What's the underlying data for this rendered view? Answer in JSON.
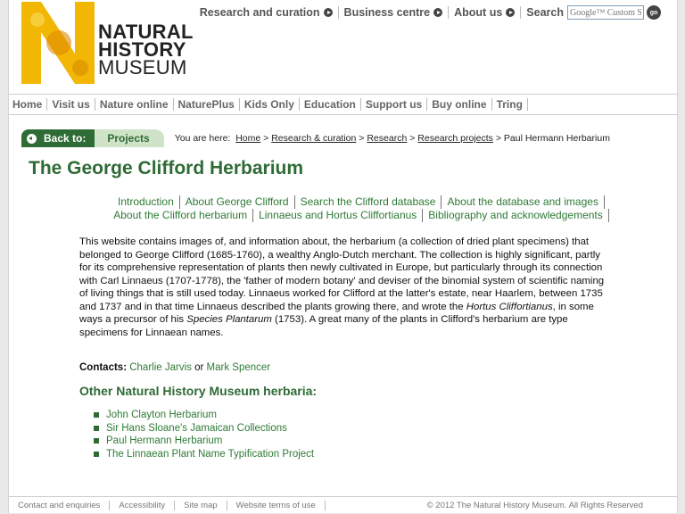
{
  "header": {
    "logo": {
      "line1": "NATURAL",
      "line2": "HISTORY",
      "line3": "MUSEUM"
    },
    "top_links": [
      {
        "label": "Research and curation"
      },
      {
        "label": "Business centre"
      },
      {
        "label": "About us"
      }
    ],
    "search": {
      "label": "Search",
      "placeholder": "Google™ Custom Search",
      "go_label": "go"
    }
  },
  "main_nav": [
    "Home",
    "Visit us",
    "Nature online",
    "NaturePlus",
    "Kids Only",
    "Education",
    "Support us",
    "Buy online",
    "Tring"
  ],
  "crumb_bar": {
    "back_label": "Back to:",
    "section_label": "Projects",
    "you_are_here": "You are here:",
    "crumbs": [
      "Home",
      "Research & curation",
      "Research",
      "Research projects"
    ],
    "separator": ">",
    "current": "Paul Hermann Herbarium"
  },
  "page_title": "The George Clifford Herbarium",
  "section_links": {
    "row1": [
      "Introduction",
      "About George Clifford",
      "Search the Clifford database",
      "About the database and images"
    ],
    "row2": [
      "About the Clifford herbarium",
      "Linnaeus and Hortus Cliffortianus",
      "Bibliography and acknowledgements"
    ]
  },
  "body": {
    "p1": "This website contains images of, and information about, the herbarium (a collection of dried plant specimens) that belonged to George Clifford (1685-1760), a wealthy Anglo-Dutch merchant. The collection is highly significant, partly for its comprehensive representation of plants then newly cultivated in Europe, but particularly through its connection with Carl Linnaeus (1707-1778), the 'father of modern botany' and deviser of the binomial system of scientific naming of living things that is still used today. Linnaeus worked for Clifford at the latter's estate, near Haarlem, between 1735 and 1737 and in that time Linnaeus described the plants growing there, and wrote the ",
    "italic1": "Hortus Cliffortianus",
    "p2": ", in some ways a precursor of his ",
    "italic2": "Species Plantarum",
    "p3": " (1753). A great many of the plants in Clifford's herbarium are type specimens for Linnaean names."
  },
  "contacts": {
    "label": "Contacts:",
    "person1": "Charlie Jarvis",
    "joiner": "or",
    "person2": "Mark Spencer"
  },
  "other_heading": "Other Natural History Museum herbaria:",
  "other_herbaria": [
    "John Clayton Herbarium",
    "Sir Hans Sloane's Jamaican Collections",
    "Paul Hermann Herbarium",
    "The Linnaean Plant Name Typification Project"
  ],
  "footer": {
    "links": [
      "Contact and enquiries",
      "Accessibility",
      "Site map",
      "Website terms of use"
    ],
    "copyright": "© 2012 The Natural History Museum. All Rights Reserved"
  },
  "colors": {
    "brand_green": "#2f6b35",
    "link_green": "#2f7a36",
    "tab_light_green": "#cfe3c8",
    "logo_yellow": "#f2b705"
  }
}
